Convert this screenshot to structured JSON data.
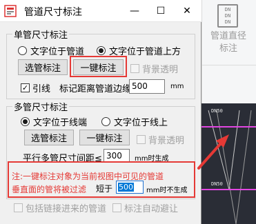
{
  "window": {
    "title": "管道尺寸标注",
    "min_glyph": "—",
    "max_glyph": "☐",
    "close_glyph": "✕"
  },
  "background": {
    "ribbon_icon_lines": [
      "DN",
      "DN",
      "DN"
    ],
    "ribbon_label_1": "管道直径",
    "ribbon_label_2": "标注",
    "cad_labels": [
      "DN50",
      "DN50"
    ]
  },
  "single": {
    "title": "单管尺寸标注",
    "radio_on_pipe": "文字位于管道",
    "radio_above_pipe": "文字位于管道上方",
    "selected": "radio_above_pipe",
    "select_btn": "选管标注",
    "one_click_btn": "一键标注",
    "bg_transparent": "背景透明",
    "leader": "引线",
    "leader_checked": true,
    "offset_label": "标记距离管道边缘",
    "offset_value": "500",
    "unit": "mm"
  },
  "multi": {
    "title": "多管尺寸标注",
    "radio_line_end": "文字位于线端",
    "radio_on_line": "文字位于线上",
    "selected": "radio_line_end",
    "select_btn": "选管标注",
    "one_click_btn": "一键标注",
    "bg_transparent": "背景透明",
    "spacing_label": "平行多管尺寸间距≤",
    "spacing_value": "300",
    "spacing_suffix": "mm时生成"
  },
  "note": {
    "line1": "注:一键标注对象为当前视图中可见的管道",
    "line2": "垂直面的管将被过滤",
    "shorter_label": "短于",
    "shorter_value": "500",
    "shorter_suffix": "mm时不生成"
  },
  "footer": {
    "include_linked": "包括链接进来的管道",
    "auto_avoid": "标注自动避让"
  }
}
